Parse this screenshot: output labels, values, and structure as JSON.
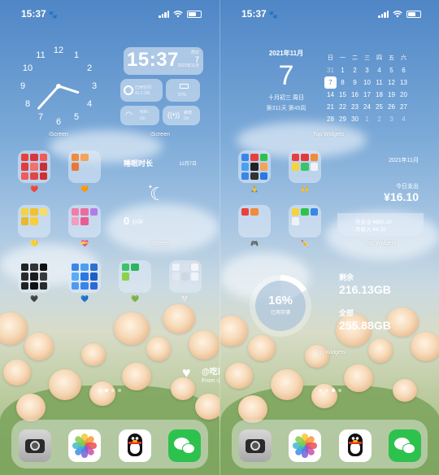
{
  "status": {
    "time": "15:37"
  },
  "left": {
    "clock_label": "iScreen",
    "clock_numbers": [
      "12",
      "1",
      "2",
      "3",
      "4",
      "5",
      "6",
      "7",
      "8",
      "9",
      "10",
      "11"
    ],
    "time_widget": {
      "time": "15:37",
      "weekday": "周日",
      "day": "7",
      "month": "2021年11月"
    },
    "storage_tile": {
      "label": "已用空间",
      "value": "41.2 GB"
    },
    "battery_tile": {
      "value": "57%"
    },
    "wifi_tile": {
      "label": "WiFi",
      "state": "On"
    },
    "cellular_tile": {
      "label": "蜂窝",
      "state": "On"
    },
    "time_widget_label": "iScreen",
    "sleep_widget": {
      "title": "睡眠时长",
      "date": "11月7日",
      "value": "0",
      "unit": "分钟"
    },
    "sleep_widget_label": "iScreen",
    "folder_emojis": [
      "❤️",
      "🧡",
      "💛",
      "💝",
      "🖤",
      "💙",
      "💚",
      "🤍"
    ],
    "watermark": {
      "title": "@吃口小麵包",
      "from": "From 小红书"
    }
  },
  "right": {
    "date_widget": {
      "month": "2021年11月",
      "day": "7",
      "lunar": "十月初三 周日",
      "progress": "第311天 第45周"
    },
    "calendar": {
      "headers": [
        "日",
        "一",
        "二",
        "三",
        "四",
        "五",
        "六"
      ],
      "weeks": [
        [
          "31",
          "1",
          "2",
          "3",
          "4",
          "5",
          "6"
        ],
        [
          "7",
          "8",
          "9",
          "10",
          "11",
          "12",
          "13"
        ],
        [
          "14",
          "15",
          "16",
          "17",
          "18",
          "19",
          "20"
        ],
        [
          "21",
          "22",
          "23",
          "24",
          "25",
          "26",
          "27"
        ],
        [
          "28",
          "29",
          "30",
          "1",
          "2",
          "3",
          "4"
        ]
      ],
      "today": "7"
    },
    "top_label_1": "Top Widgets",
    "expense_widget": {
      "month": "2021年11月",
      "today_label": "今日支出",
      "today_value": "¥16.10",
      "month_expense": "月支出 ¥660.20",
      "month_income": "月收入 ¥4.15"
    },
    "top_label_2": "Top Widgets",
    "folder_emojis": [
      "🙏",
      "🙌",
      "🎮",
      "✏️"
    ],
    "storage_widget": {
      "percent": "16%",
      "used_label": "已用存储",
      "free_label": "剩余",
      "free_value": "216.13GB",
      "total_label": "全部",
      "total_value": "255.88GB"
    },
    "top_label_3": "Top Widgets"
  },
  "colors": {
    "wechat": "#2dc24d",
    "sky": "#6f9fd0",
    "rose": "#f6d9b8"
  },
  "dock_icons": [
    "camera-icon",
    "photos-icon",
    "qq-icon",
    "wechat-icon"
  ]
}
